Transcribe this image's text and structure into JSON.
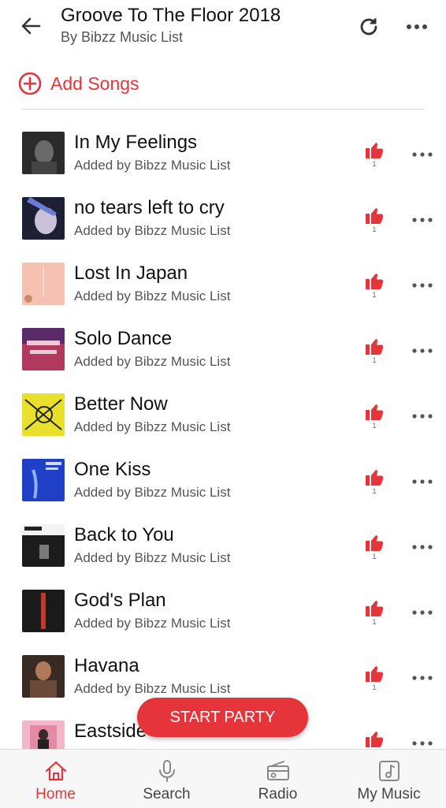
{
  "header": {
    "title": "Groove To The Floor 2018",
    "subtitle": "By Bibzz Music List"
  },
  "add_songs": {
    "label": "Add Songs"
  },
  "songs": [
    {
      "title": "In My Feelings",
      "added_by": "Added by Bibzz Music List",
      "likes": "1"
    },
    {
      "title": "no tears left to cry",
      "added_by": "Added by Bibzz Music List",
      "likes": "1"
    },
    {
      "title": "Lost In Japan",
      "added_by": "Added by Bibzz Music List",
      "likes": "1"
    },
    {
      "title": "Solo Dance",
      "added_by": "Added by Bibzz Music List",
      "likes": "1"
    },
    {
      "title": "Better Now",
      "added_by": "Added by Bibzz Music List",
      "likes": "1"
    },
    {
      "title": "One Kiss",
      "added_by": "Added by Bibzz Music List",
      "likes": "1"
    },
    {
      "title": "Back to You",
      "added_by": "Added by Bibzz Music List",
      "likes": "1"
    },
    {
      "title": "God's Plan",
      "added_by": "Added by Bibzz Music List",
      "likes": "1"
    },
    {
      "title": "Havana",
      "added_by": "Added by Bibzz Music List",
      "likes": "1"
    },
    {
      "title": "Eastside",
      "added_by": "",
      "likes": ""
    }
  ],
  "start_party": {
    "label": "START PARTY"
  },
  "nav": {
    "items": [
      {
        "label": "Home",
        "icon": "home-icon"
      },
      {
        "label": "Search",
        "icon": "microphone-icon"
      },
      {
        "label": "Radio",
        "icon": "radio-icon"
      },
      {
        "label": "My Music",
        "icon": "music-note-icon"
      }
    ]
  },
  "colors": {
    "accent": "#e5353b",
    "text": "#111111",
    "muted": "#555555"
  }
}
